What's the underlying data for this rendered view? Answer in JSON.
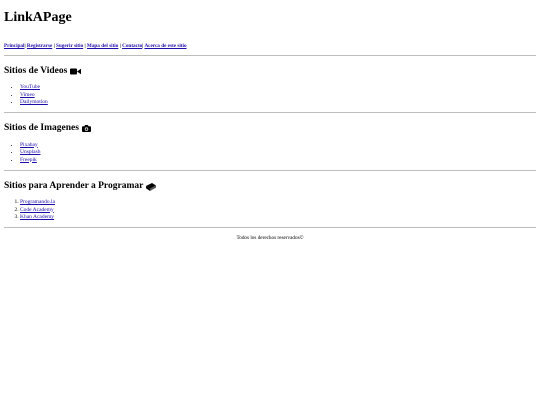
{
  "site": {
    "title": "LinkAPage"
  },
  "nav": {
    "items": [
      "Principal",
      "Registrarse",
      "Sugerir sitio",
      "Mapa del sitio",
      "Contacto",
      "Acerca de este sitio"
    ],
    "separator": "|"
  },
  "sections": [
    {
      "title": "Sitios de Videos",
      "icon": "video-camera-icon",
      "list_type": "unordered",
      "items": [
        "YouTube",
        "Vimeo",
        "Dailymotion"
      ]
    },
    {
      "title": "Sitios de Imagenes",
      "icon": "camera-icon",
      "list_type": "unordered",
      "items": [
        "Pixabay",
        "Unsplash",
        "Freepik"
      ]
    },
    {
      "title": "Sitios para Aprender a Programar",
      "icon": "book-icon",
      "list_type": "ordered",
      "items": [
        "Programando.la",
        "Code Academy",
        "Khan Academy"
      ]
    }
  ],
  "footer": {
    "text": "Todos los derechos reservados©"
  },
  "colors": {
    "link": "#1a0dab",
    "divider": "#bdbdbd",
    "text": "#000000"
  }
}
